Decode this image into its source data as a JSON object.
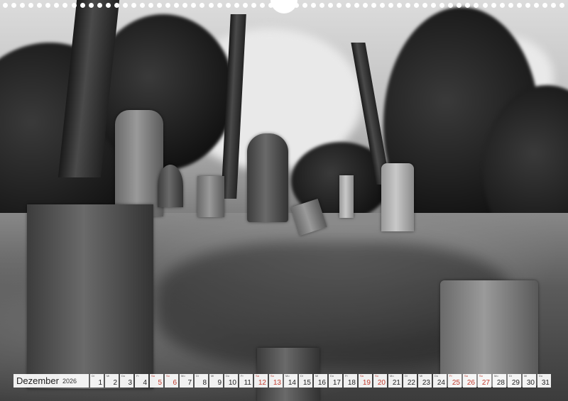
{
  "calendar": {
    "month": "Dezember",
    "year": "2026",
    "days": [
      {
        "dow": "Di",
        "num": "1",
        "red": false
      },
      {
        "dow": "Mi",
        "num": "2",
        "red": false
      },
      {
        "dow": "Do",
        "num": "3",
        "red": false
      },
      {
        "dow": "Fr",
        "num": "4",
        "red": false
      },
      {
        "dow": "Sa",
        "num": "5",
        "red": true
      },
      {
        "dow": "So",
        "num": "6",
        "red": true
      },
      {
        "dow": "Mo",
        "num": "7",
        "red": false
      },
      {
        "dow": "Di",
        "num": "8",
        "red": false
      },
      {
        "dow": "Mi",
        "num": "9",
        "red": false
      },
      {
        "dow": "Do",
        "num": "10",
        "red": false
      },
      {
        "dow": "Fr",
        "num": "11",
        "red": false
      },
      {
        "dow": "Sa",
        "num": "12",
        "red": true
      },
      {
        "dow": "So",
        "num": "13",
        "red": true
      },
      {
        "dow": "Mo",
        "num": "14",
        "red": false
      },
      {
        "dow": "Di",
        "num": "15",
        "red": false
      },
      {
        "dow": "Mi",
        "num": "16",
        "red": false
      },
      {
        "dow": "Do",
        "num": "17",
        "red": false
      },
      {
        "dow": "Fr",
        "num": "18",
        "red": false
      },
      {
        "dow": "Sa",
        "num": "19",
        "red": true
      },
      {
        "dow": "So",
        "num": "20",
        "red": true
      },
      {
        "dow": "Mo",
        "num": "21",
        "red": false
      },
      {
        "dow": "Di",
        "num": "22",
        "red": false
      },
      {
        "dow": "Mi",
        "num": "23",
        "red": false
      },
      {
        "dow": "Do",
        "num": "24",
        "red": false
      },
      {
        "dow": "Fr",
        "num": "25",
        "red": true
      },
      {
        "dow": "Sa",
        "num": "26",
        "red": true
      },
      {
        "dow": "So",
        "num": "27",
        "red": true
      },
      {
        "dow": "Mo",
        "num": "28",
        "red": false
      },
      {
        "dow": "Di",
        "num": "29",
        "red": false
      },
      {
        "dow": "Mi",
        "num": "30",
        "red": false
      },
      {
        "dow": "Do",
        "num": "31",
        "red": false
      }
    ]
  },
  "colors": {
    "weekday_text": "#222222",
    "holiday_text": "#c0392b",
    "cell_background": "#ffffff"
  }
}
